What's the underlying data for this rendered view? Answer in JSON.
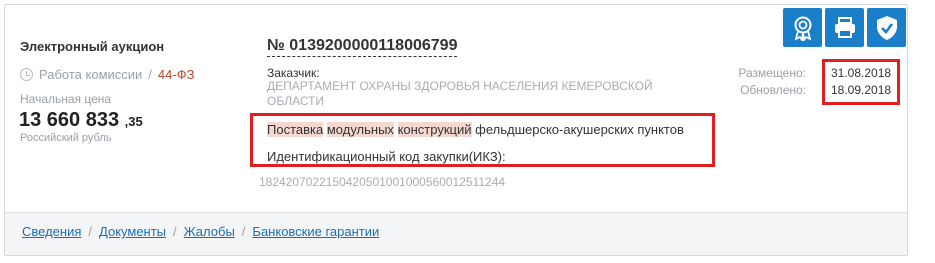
{
  "card": {
    "type": "Электронный аукцион",
    "stage": "Работа комиссии",
    "stage_separator": "/",
    "law": "44-ФЗ",
    "price_label": "Начальная цена",
    "price_main": "13 660 833",
    "price_cents": ",35",
    "currency": "Российский рубль",
    "number": "№ 0139200000118006799",
    "customer_label": "Заказчик:",
    "customer_name": "ДЕПАРТАМЕНТ ОХРАНЫ ЗДОРОВЬЯ НАСЕЛЕНИЯ КЕМЕРОВСКОЙ ОБЛАСТИ",
    "subject_parts": [
      "Поставка",
      "модульных",
      "конструкций",
      "фельдшерско-акушерских пунктов"
    ],
    "ikz_label": "Идентификационный код закупки(ИКЗ):",
    "ikz": "182420702215042050100100056001251l1244",
    "placed_label": "Размещено:",
    "placed_date": "31.08.2018",
    "updated_label": "Обновлено:",
    "updated_date": "18.09.2018"
  },
  "actions": {
    "icons": [
      "award-icon",
      "printer-icon",
      "shield-check-icon"
    ],
    "color": "#1a7fc8"
  },
  "footer": {
    "links": [
      "Сведения",
      "Документы",
      "Жалобы",
      "Банковские гарантии"
    ],
    "separator": "/"
  },
  "colors": {
    "accent": "#1a7fc8",
    "law": "#c0452a",
    "highlight_box": "#e02020",
    "keyword_highlight": "#f6d8d3"
  }
}
